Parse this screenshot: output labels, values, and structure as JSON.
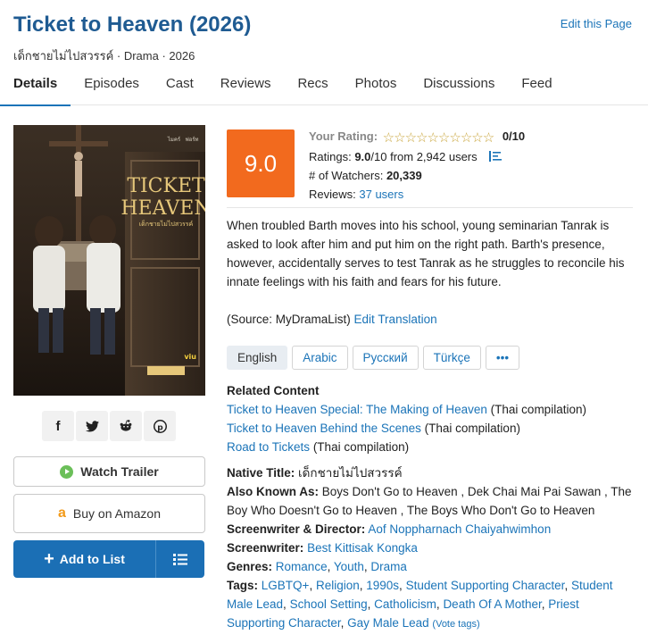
{
  "header": {
    "title": "Ticket to Heaven (2026)",
    "subtitle": "เด็กชายไม่ไปสวรรค์ · Drama · 2026",
    "edit_link": "Edit this Page"
  },
  "tabs": [
    "Details",
    "Episodes",
    "Cast",
    "Reviews",
    "Recs",
    "Photos",
    "Discussions",
    "Feed"
  ],
  "poster": {
    "title_line1": "TICKET",
    "title_line2": "HEAVEN",
    "thai_caption": "เด็กชายไม่ไปสวรรค์",
    "cast_left": "ไมคร์",
    "cast_right": "ฟอร์ท",
    "platform": "viu"
  },
  "share": [
    "facebook-icon",
    "twitter-icon",
    "reddit-icon",
    "pinterest-icon"
  ],
  "buttons": {
    "watch_trailer": "Watch Trailer",
    "buy_amazon": "Buy on Amazon",
    "add_to_list": "Add to List"
  },
  "rating": {
    "score": "9.0",
    "your_rating_label": "Your Rating:",
    "your_rating_value": "0/10",
    "ratings_label": "Ratings:",
    "ratings_value": "9.0",
    "ratings_rest": "/10 from 2,942 users",
    "watchers_label": "# of Watchers:",
    "watchers_value": "20,339",
    "reviews_label": "Reviews:",
    "reviews_value": "37 users",
    "stars_filled": 0,
    "stars_total": 10
  },
  "synopsis": "When troubled Barth moves into his school, young seminarian Tanrak is asked to look after him and put him on the right path. Barth's presence, however, accidentally serves to test Tanrak as he struggles to reconcile his innate feelings with his faith and fears for his future.",
  "source": {
    "text": "(Source: MyDramaList)",
    "link": "Edit Translation"
  },
  "languages": [
    "English",
    "Arabic",
    "Русский",
    "Türkçe",
    "•••"
  ],
  "related": {
    "heading": "Related Content",
    "items": [
      {
        "title": "Ticket to Heaven Special: The Making of Heaven",
        "note": "(Thai compilation)"
      },
      {
        "title": "Ticket to Heaven Behind the Scenes",
        "note": "(Thai compilation)"
      },
      {
        "title": "Road to Tickets",
        "note": "(Thai compilation)"
      }
    ]
  },
  "details": {
    "native_label": "Native Title:",
    "native_value": "เด็กชายไม่ไปสวรรค์",
    "aka_label": "Also Known As:",
    "aka_value": "Boys Don't Go to Heaven , Dek Chai Mai Pai Sawan , The Boy Who Doesn't Go to Heaven , The Boys Who Don't Go to Heaven",
    "sd_label": "Screenwriter & Director:",
    "sd_value": "Aof Noppharnach Chaiyahwimhon",
    "sw_label": "Screenwriter:",
    "sw_value": "Best Kittisak Kongka",
    "genres_label": "Genres:",
    "genres": [
      "Romance",
      "Youth",
      "Drama"
    ],
    "tags_label": "Tags:",
    "tags": [
      "LGBTQ+",
      "Religion",
      "1990s",
      "Student Supporting Character",
      "Student Male Lead",
      "School Setting",
      "Catholicism",
      "Death Of A Mother",
      "Priest Supporting Character",
      "Gay Male Lead"
    ],
    "vote_tags": "(Vote tags)"
  },
  "colors": {
    "accent": "#1b74b8",
    "score_bg": "#f26a1e",
    "add_button": "#1b6fb5",
    "title": "#1f5b92"
  }
}
